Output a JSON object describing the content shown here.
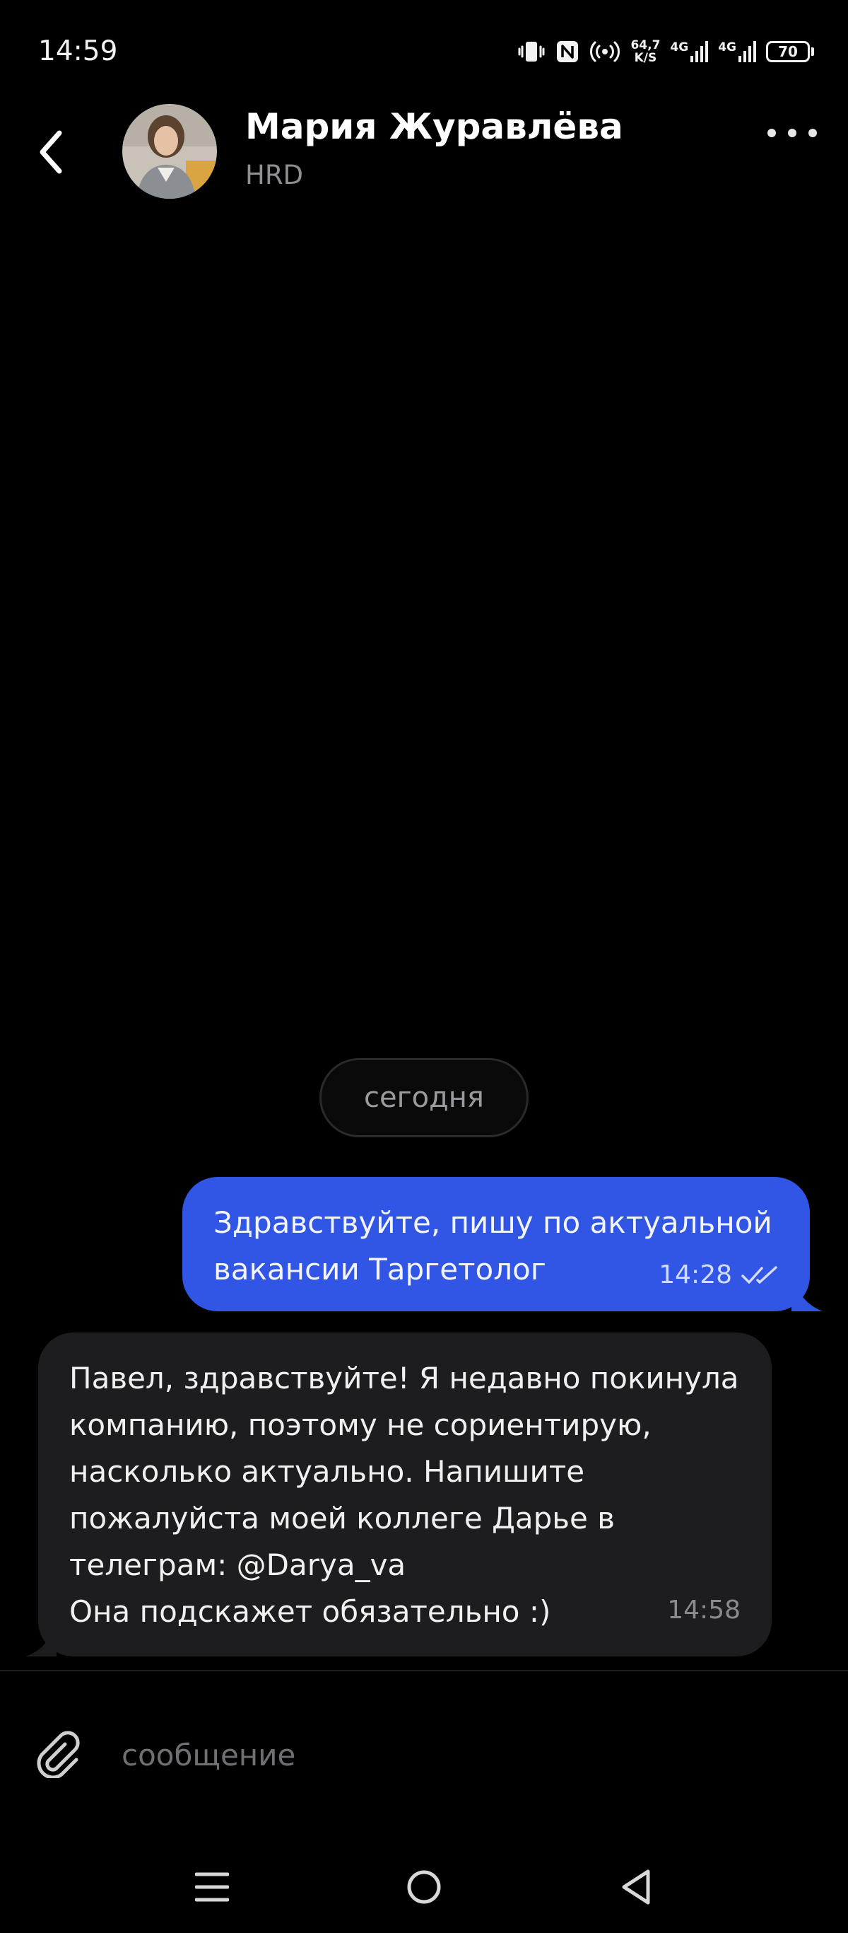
{
  "status_bar": {
    "time": "14:59",
    "speed_value": "64,7",
    "speed_unit": "K/S",
    "network_1": "4G",
    "network_2": "4G",
    "battery": "70"
  },
  "header": {
    "contact_name": "Мария Журавлёва",
    "contact_role": "HRD"
  },
  "date_separator": "сегодня",
  "messages": [
    {
      "direction": "outgoing",
      "lines": [
        "Здравствуйте, пишу по актуальной",
        "вакансии Таргетолог"
      ],
      "time": "14:28",
      "status": "read"
    },
    {
      "direction": "incoming",
      "lines": [
        "Павел, здравствуйте! Я недавно покинула",
        "компанию, поэтому не сориентирую,",
        "насколько актуально. Напишите",
        "пожалуйста моей коллеге Дарье в",
        "телеграм: @Darya_va",
        "Она подскажет обязательно :)"
      ],
      "time": "14:58"
    }
  ],
  "composer": {
    "placeholder": "сообщение",
    "value": ""
  },
  "icons": {
    "back": "chevron-left-icon",
    "more": "more-dots-icon",
    "attach": "paperclip-icon",
    "read_status": "double-check-icon",
    "nav_menu": "menu-icon",
    "nav_home": "home-circle-icon",
    "nav_back": "back-triangle-icon"
  },
  "colors": {
    "background": "#000000",
    "outgoing_bubble": "#3155e4",
    "incoming_bubble": "#1d1d1f",
    "secondary_text": "#8e8e93"
  }
}
